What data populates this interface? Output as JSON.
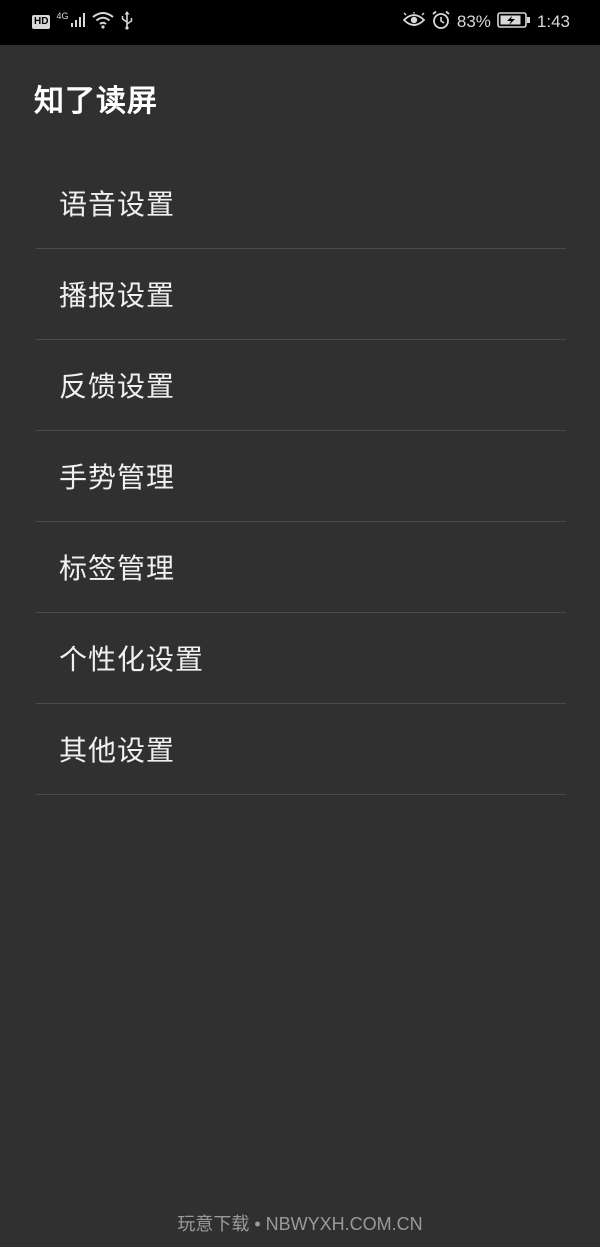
{
  "status_bar": {
    "hd_label": "HD",
    "network_label": "4G",
    "battery_percent": "83%",
    "time": "1:43",
    "icons": [
      "hd-icon",
      "signal-icon",
      "wifi-icon",
      "usb-icon",
      "eye-icon",
      "alarm-icon",
      "battery-charging-icon"
    ]
  },
  "app": {
    "title": "知了读屏"
  },
  "menu": {
    "items": [
      {
        "label": "语音设置"
      },
      {
        "label": "播报设置"
      },
      {
        "label": "反馈设置"
      },
      {
        "label": "手势管理"
      },
      {
        "label": "标签管理"
      },
      {
        "label": "个性化设置"
      },
      {
        "label": "其他设置"
      }
    ]
  },
  "watermark": {
    "text": "玩意下载 • NBWYXH.COM.CN"
  },
  "colors": {
    "background": "#303030",
    "status_bar": "#000000",
    "divider": "#4a4a4a",
    "text": "#f0f0f0"
  }
}
